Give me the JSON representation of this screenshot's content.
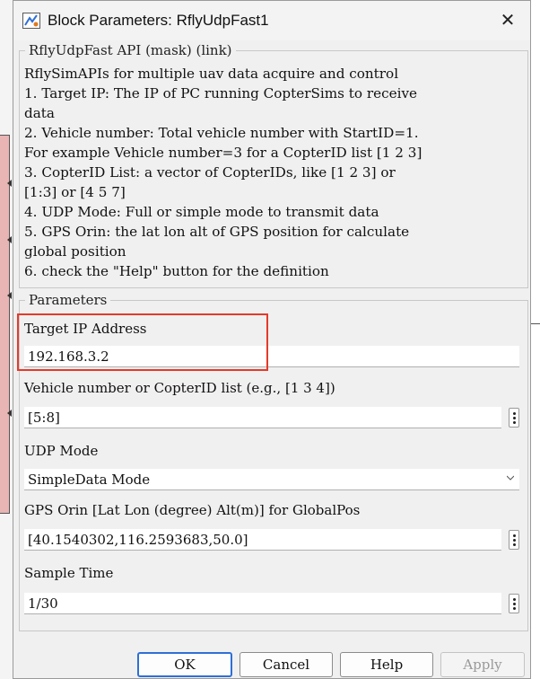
{
  "window": {
    "title": "Block Parameters: RflyUdpFast1",
    "close_glyph": "✕"
  },
  "mask": {
    "group_title": "RflyUdpFast API (mask) (link)",
    "description_lines": [
      "RflySimAPIs for multiple uav data acquire and control",
      "1. Target IP: The IP of PC running CopterSims to receive",
      "data",
      "2. Vehicle number: Total vehicle number with StartID=1.",
      "For example Vehicle number=3 for a CopterID list [1 2 3]",
      "3. CopterID List: a vector of CopterIDs, like [1 2 3] or",
      "[1:3] or [4 5 7]",
      "4. UDP Mode: Full or simple mode to transmit data",
      "5. GPS Orin: the lat lon alt of GPS position for calculate",
      "global position",
      "6. check the \"Help\" button for the definition"
    ]
  },
  "parameters": {
    "group_title": "Parameters",
    "target_ip": {
      "label": "Target IP Address",
      "value": "192.168.3.2"
    },
    "vehicle": {
      "label": "Vehicle number or CopterID list (e.g., [1 3 4])",
      "value": "[5:8]"
    },
    "udp_mode": {
      "label": "UDP Mode",
      "value": "SimpleData Mode"
    },
    "gps_orin": {
      "label": "GPS Orin [Lat Lon (degree) Alt(m)] for GlobalPos",
      "value": "[40.1540302,116.2593683,50.0]"
    },
    "sample_time": {
      "label": "Sample Time",
      "value": "1/30"
    }
  },
  "buttons": {
    "ok": "OK",
    "cancel": "Cancel",
    "help": "Help",
    "apply": "Apply"
  },
  "colors": {
    "highlight": "#e43a2b",
    "focus_border": "#2f6fd6"
  },
  "icons": {
    "app": "simulink-block-icon",
    "close": "close-icon",
    "menu": "vertical-ellipsis-icon",
    "dropdown": "chevron-down-icon"
  }
}
